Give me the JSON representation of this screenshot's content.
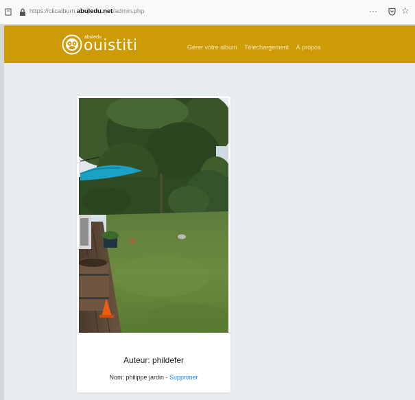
{
  "browser": {
    "url_prefix": "https://",
    "url_domain_pre": "clicalbum.",
    "url_domain_bold": "abuledu.net",
    "url_path": "/admin.php",
    "menu_label": "···"
  },
  "header": {
    "logo_small": "abuledu",
    "logo_big": "ouistiti",
    "nav": [
      "Gérer votre album",
      "Téléchargement",
      "À propos"
    ]
  },
  "photo_card": {
    "author_label": "Auteur: phildefer",
    "name_label": "Nom: philippe jardin - ",
    "delete_label": "Supprimer"
  },
  "colors": {
    "header_bg": "#cd9b06",
    "page_bg": "#e9ecef",
    "link_blue": "#1e88e5"
  }
}
